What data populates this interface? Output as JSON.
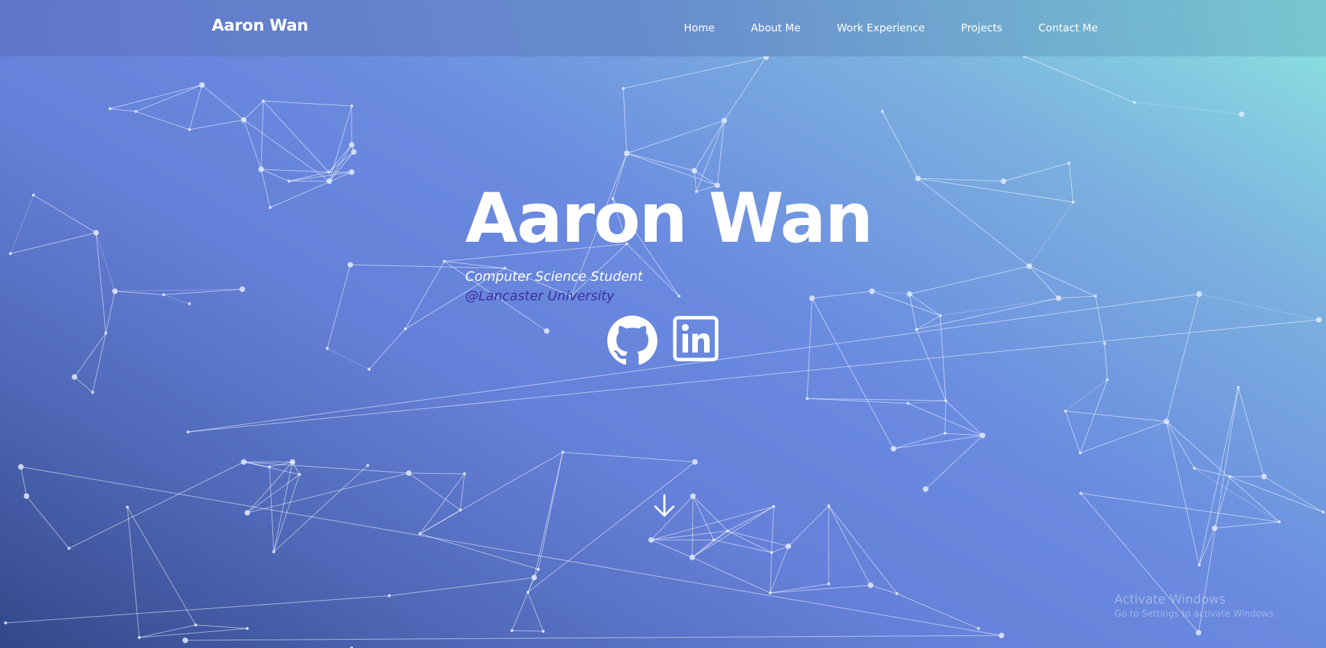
{
  "navbar": {
    "brand": "Aaron Wan",
    "links": [
      {
        "label": "Home"
      },
      {
        "label": "About Me"
      },
      {
        "label": "Work Experience"
      },
      {
        "label": "Projects"
      },
      {
        "label": "Contact Me"
      }
    ]
  },
  "hero": {
    "name": "Aaron Wan",
    "subtitle": "Computer Science Student",
    "university": "@Lancaster University",
    "university_color": "#3d2f9e"
  },
  "socials": [
    {
      "icon": "github-icon"
    },
    {
      "icon": "linkedin-icon"
    }
  ],
  "scroll": {
    "icon": "arrow-down-icon"
  },
  "watermark": {
    "title": "Activate Windows",
    "subtitle": "Go to Settings to activate Windows."
  },
  "colors": {
    "gradient_top_right": "#8ce5e1",
    "gradient_mid": "#6a8ae0",
    "gradient_bottom_left": "#33478a",
    "text": "#ffffff"
  }
}
